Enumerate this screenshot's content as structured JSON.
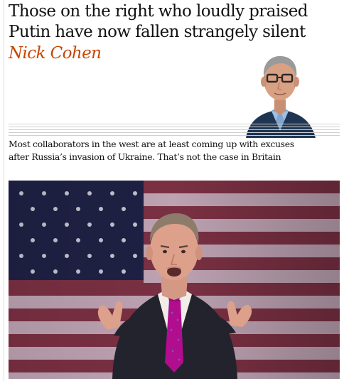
{
  "article": {
    "headline": "Those on the right who loudly praised Putin have now fallen strangely silent",
    "byline": "Nick Cohen",
    "standfirst": "Most collaborators in the west are at least coming up with excuses after Russia’s invasion of Ukraine. That’s not the case in Britain"
  },
  "colors": {
    "byline": "#c74600",
    "headline_text": "#121212",
    "divider_lines": "#cfcfcf"
  }
}
